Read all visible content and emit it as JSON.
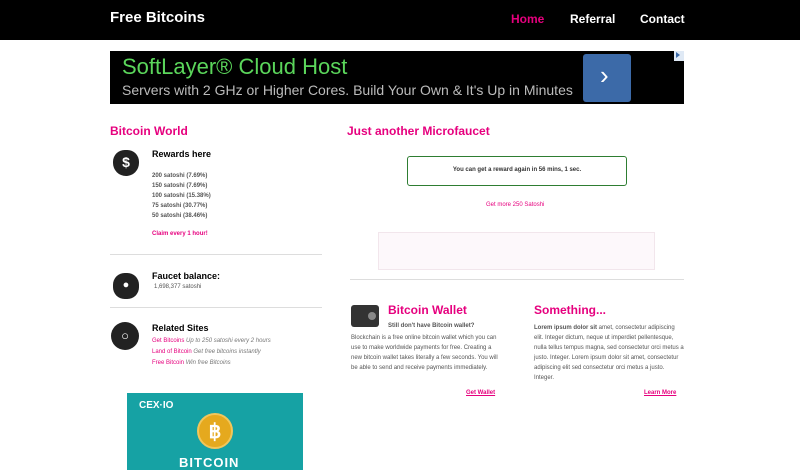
{
  "brand": "Free Bitcoins",
  "nav": [
    {
      "label": "Home"
    },
    {
      "label": "Referral"
    },
    {
      "label": "Contact"
    }
  ],
  "ad": {
    "title": "SoftLayer® Cloud Host",
    "subtitle": "Servers with 2 GHz or Higher Cores. Build Your Own & It's Up in Minutes",
    "arrow": "›"
  },
  "sidebar": {
    "title": "Bitcoin World",
    "rewards_title": "Rewards here",
    "rewards": [
      "200 satoshi (7.69%)",
      "150 satoshi (7.69%)",
      "100 satoshi (15.38%)",
      "75 satoshi (30.77%)",
      "50 satoshi (38.46%)"
    ],
    "claim": "Claim every 1 hour!",
    "balance_title": "Faucet balance:",
    "balance_value": "1,698,377 satoshi",
    "related_title": "Related Sites",
    "related": [
      {
        "name": "Get Bitcoins",
        "desc": "Up to 250 satoshi every 2 hours"
      },
      {
        "name": "Land of Bitcoin",
        "desc": "Get free bitcoins instantly"
      },
      {
        "name": "Free Bitcoin",
        "desc": "Win free Bitcoins"
      }
    ],
    "cex_logo": "CEX·IO",
    "cex_text": "BITCOIN"
  },
  "main": {
    "title": "Just another Microfaucet",
    "notice": "You can get a reward again in 56 mins, 1 sec.",
    "get_more": "Get more 250 Satoshi",
    "wallet_title": "Bitcoin Wallet",
    "wallet_subtitle": "Still don't have Bitcoin wallet?",
    "wallet_text": "Blockchain is a free online bitcoin wallet which you can use to make worldwide payments for free. Creating a new bitcoin wallet takes literally a few seconds. You will be able to send and receive payments immediately.",
    "get_wallet": "Get Wallet",
    "something_title": "Something...",
    "something_bold": "Lorem ipsum dolor sit",
    "something_text": " amet, consectetur adipiscing elit. Integer dictum, neque ut imperdiet pellentesque, nulla tellus tempus magna, sed consectetur orci metus a justo. Integer. Lorem ipsum dolor sit amet, consectetur adipiscing elit sed consectetur orci metus a justo. Integer.",
    "learn_more": "Learn More"
  },
  "colors": {
    "accent": "#e6007e",
    "topbar": "#000000",
    "ad_green": "#5bd65b",
    "ad_button": "#3c6aa8",
    "cex_teal": "#16a2a4"
  }
}
